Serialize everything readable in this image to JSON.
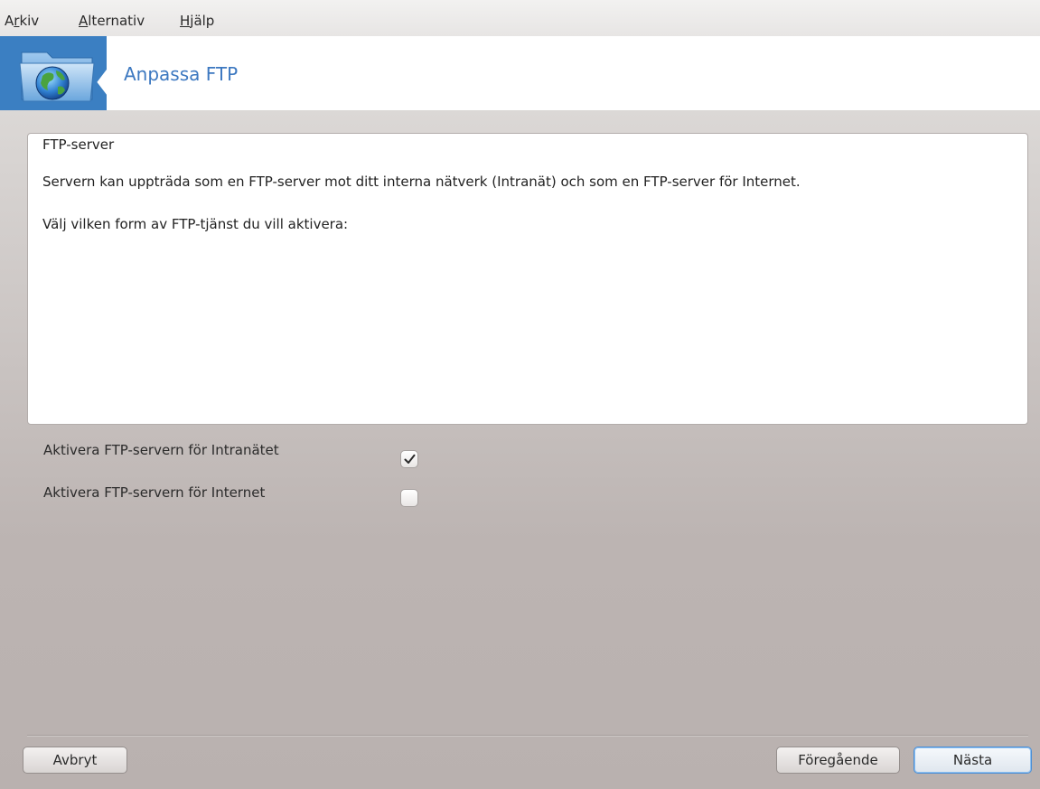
{
  "menubar": {
    "arkiv": {
      "accel": "r",
      "pre": "A",
      "post": "kiv"
    },
    "alternativ": {
      "accel": "A",
      "pre": "",
      "post": "lternativ"
    },
    "hjalp": {
      "accel": "H",
      "pre": "",
      "post": "jälp"
    }
  },
  "banner": {
    "title": "Anpassa FTP",
    "icon": "network-folder-icon",
    "accent_color": "#3c78c0"
  },
  "panel": {
    "heading": "FTP-server",
    "description": "Servern kan uppträda som en FTP-server mot ditt interna nätverk (Intranät) och som en FTP-server för Internet.",
    "prompt": "Välj vilken form av FTP-tjänst du vill aktivera:"
  },
  "options": [
    {
      "label": "Aktivera FTP-servern för Intranätet",
      "checked": true
    },
    {
      "label": "Aktivera FTP-servern för Internet",
      "checked": false
    }
  ],
  "buttons": {
    "cancel": "Avbryt",
    "previous": "Föregående",
    "next": "Nästa"
  }
}
